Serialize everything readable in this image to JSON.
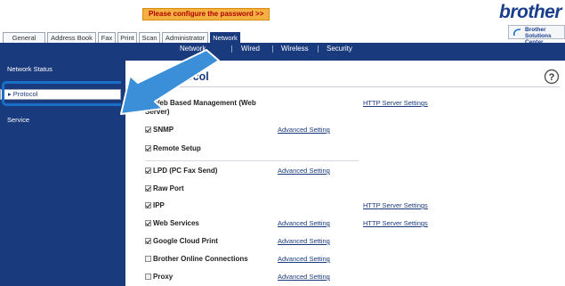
{
  "header": {
    "password_warning": "Please configure the password >>",
    "logo": "brother",
    "solutions_line1": "Brother",
    "solutions_line2": "Solutions Center"
  },
  "tabs": [
    {
      "label": "General"
    },
    {
      "label": "Address Book"
    },
    {
      "label": "Fax"
    },
    {
      "label": "Print"
    },
    {
      "label": "Scan"
    },
    {
      "label": "Administrator"
    },
    {
      "label": "Network"
    }
  ],
  "subnav": {
    "items": [
      {
        "label": "Network"
      },
      {
        "label": "Wired"
      },
      {
        "label": "Wireless"
      },
      {
        "label": "Security"
      }
    ]
  },
  "sidebar": {
    "items": [
      {
        "label": "Network Status"
      },
      {
        "label": "Protocol"
      },
      {
        "label": "Service"
      }
    ]
  },
  "main": {
    "title": "Protocol",
    "rows": [
      {
        "label_line1": "Web Based Management (Web",
        "label_line2": "Server)",
        "checked": true,
        "link2": "HTTP Server Settings"
      },
      {
        "label": "SNMP",
        "checked": true,
        "link1": "Advanced Setting"
      },
      {
        "label": "Remote Setup",
        "checked": true
      },
      {
        "label": "LPD (PC Fax Send)",
        "checked": true,
        "link1": "Advanced Setting"
      },
      {
        "label": "Raw Port",
        "checked": true
      },
      {
        "label": "IPP",
        "checked": true,
        "link2": "HTTP Server Settings"
      },
      {
        "label": "Web Services",
        "checked": true,
        "link1": "Advanced Setting",
        "link2": "HTTP Server Settings"
      },
      {
        "label": "Google Cloud Print",
        "checked": true,
        "link1": "Advanced Setting"
      },
      {
        "label": "Brother Online Connections",
        "checked": false,
        "link1": "Advanced Setting"
      },
      {
        "label": "Proxy",
        "checked": false,
        "link1": "Advanced Setting"
      }
    ]
  },
  "colors": {
    "nav_blue": "#1a3a7e",
    "warning_orange": "#f4b040",
    "highlight_blue": "#1a70c8"
  },
  "icons": {
    "help": "help-circle-icon",
    "arrow": "pointer-arrow-icon"
  }
}
